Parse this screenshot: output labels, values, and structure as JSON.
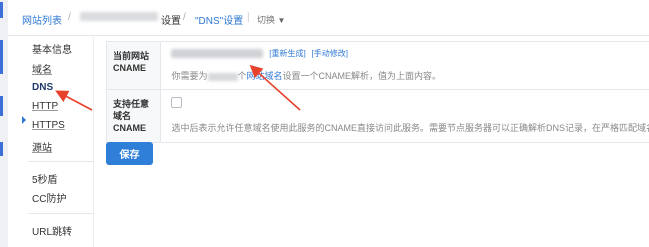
{
  "breadcrumb": {
    "site_list": "网站列表",
    "separator": "/",
    "settings": "设置",
    "current": "\"DNS\"设置",
    "switch_label": "切换"
  },
  "sidebar": {
    "items": [
      {
        "label": "基本信息"
      },
      {
        "label": "域名"
      },
      {
        "label": "DNS"
      },
      {
        "label": "HTTP"
      },
      {
        "label": "HTTPS"
      },
      {
        "label": "源站"
      },
      {
        "label": "5秒盾"
      },
      {
        "label": "CC防护"
      },
      {
        "label": "URL跳转"
      }
    ]
  },
  "form": {
    "cname_label": "当前网站CNAME",
    "regenerate_link": "[重新生成]",
    "manual_modify_link": "[手动修改]",
    "hint_prefix": "你需要为",
    "hint_middle": "个",
    "hint_link": "网站域名",
    "hint_suffix": "设置一个CNAME解析，值为上面内容。",
    "any_domain_label": "支持任意域名CNAME",
    "any_domain_hint": "选中后表示允许任意域名使用此服务的CNAME直接访问此服务。需要节点服务器可以正确解析DNS记录，在严格匹配域名"
  },
  "actions": {
    "save_label": "保存"
  },
  "colors": {
    "accent": "#2f7fd9",
    "annotation_arrow": "#e8412c"
  }
}
